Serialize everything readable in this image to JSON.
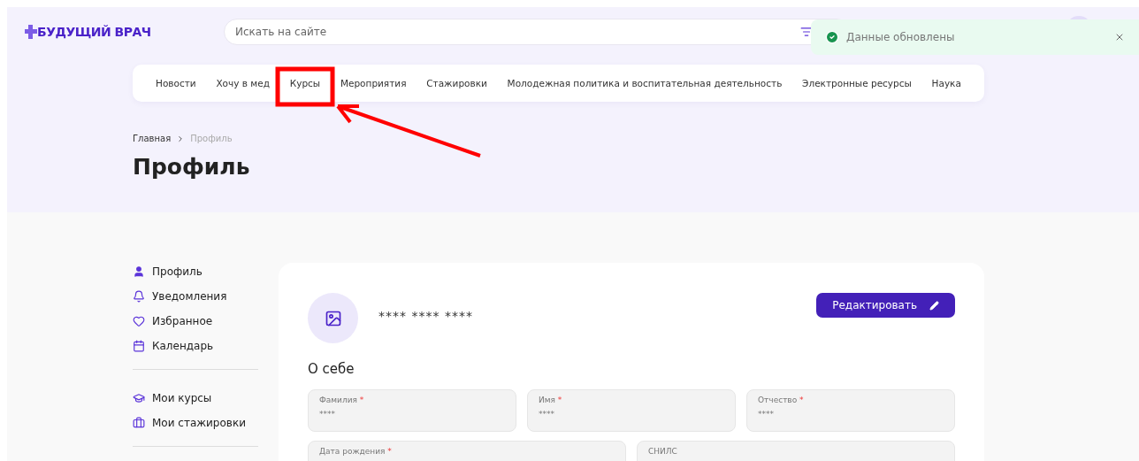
{
  "header": {
    "logo": "БУДУЩИЙ ВРАЧ",
    "search": {
      "placeholder": "Искать на сайте"
    }
  },
  "toast": {
    "message": "Данные обновлены",
    "kind": "success"
  },
  "nav": [
    "Новости",
    "Хочу в мед",
    "Курсы",
    "Мероприятия",
    "Стажировки",
    "Молодежная политика и воспитательная деятельность",
    "Электронные ресурсы",
    "Наука"
  ],
  "breadcrumbs": [
    {
      "label": "Главная",
      "current": false
    },
    {
      "label": "Профиль",
      "current": true
    }
  ],
  "page_title": "Профиль",
  "sidebar": {
    "groups": [
      [
        {
          "label": "Профиль"
        },
        {
          "label": "Уведомления"
        },
        {
          "label": "Избранное"
        },
        {
          "label": "Календарь"
        }
      ],
      [
        {
          "label": "Мои курсы"
        },
        {
          "label": "Мои стажировки"
        }
      ]
    ]
  },
  "profile": {
    "name": "**** **** ****",
    "edit_button": "Редактировать",
    "section_title": "О себе",
    "fields": [
      {
        "label": "Фамилия",
        "required_mark": "*",
        "value": "****"
      },
      {
        "label": "Имя",
        "required_mark": "*",
        "value": "****"
      },
      {
        "label": "Отчество",
        "required_mark": "*",
        "value": "****"
      },
      {
        "label": "Дата рождения",
        "required_mark": "*"
      },
      {
        "label": "СНИЛС"
      }
    ]
  }
}
